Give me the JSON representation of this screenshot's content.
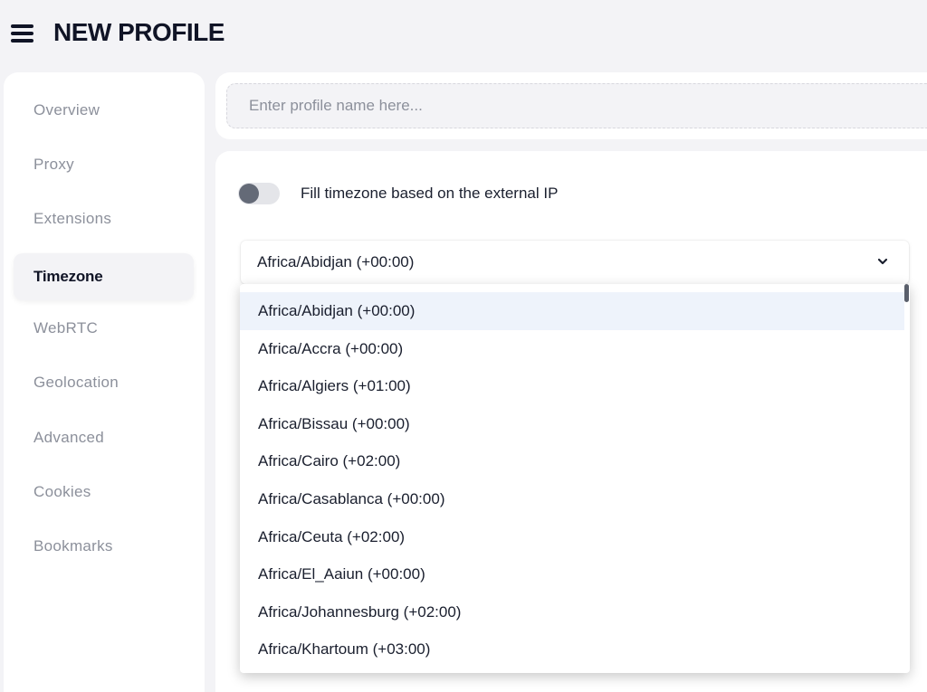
{
  "header": {
    "title": "NEW PROFILE",
    "menu_icon": "hamburger-menu-icon"
  },
  "sidebar": {
    "items": [
      {
        "label": "Overview",
        "active": false
      },
      {
        "label": "Proxy",
        "active": false
      },
      {
        "label": "Extensions",
        "active": false
      },
      {
        "label": "Timezone",
        "active": true
      },
      {
        "label": "WebRTC",
        "active": false
      },
      {
        "label": "Geolocation",
        "active": false
      },
      {
        "label": "Advanced",
        "active": false
      },
      {
        "label": "Cookies",
        "active": false
      },
      {
        "label": "Bookmarks",
        "active": false
      }
    ]
  },
  "profile_name": {
    "value": "",
    "placeholder": "Enter profile name here..."
  },
  "timezone": {
    "fill_from_ip_label": "Fill timezone based on the external IP",
    "fill_from_ip_enabled": false,
    "selected": "Africa/Abidjan (+00:00)",
    "chevron_icon": "chevron-down-icon",
    "options": [
      "Africa/Abidjan (+00:00)",
      "Africa/Accra (+00:00)",
      "Africa/Algiers (+01:00)",
      "Africa/Bissau (+00:00)",
      "Africa/Cairo (+02:00)",
      "Africa/Casablanca (+00:00)",
      "Africa/Ceuta (+02:00)",
      "Africa/El_Aaiun (+00:00)",
      "Africa/Johannesburg (+02:00)",
      "Africa/Khartoum (+03:00)"
    ],
    "highlighted_index": 0
  },
  "colors": {
    "background": "#f3f3f6",
    "card": "#ffffff",
    "text_primary": "#1a1f2e",
    "text_muted": "#8c909b",
    "highlight": "#eef3fb"
  }
}
